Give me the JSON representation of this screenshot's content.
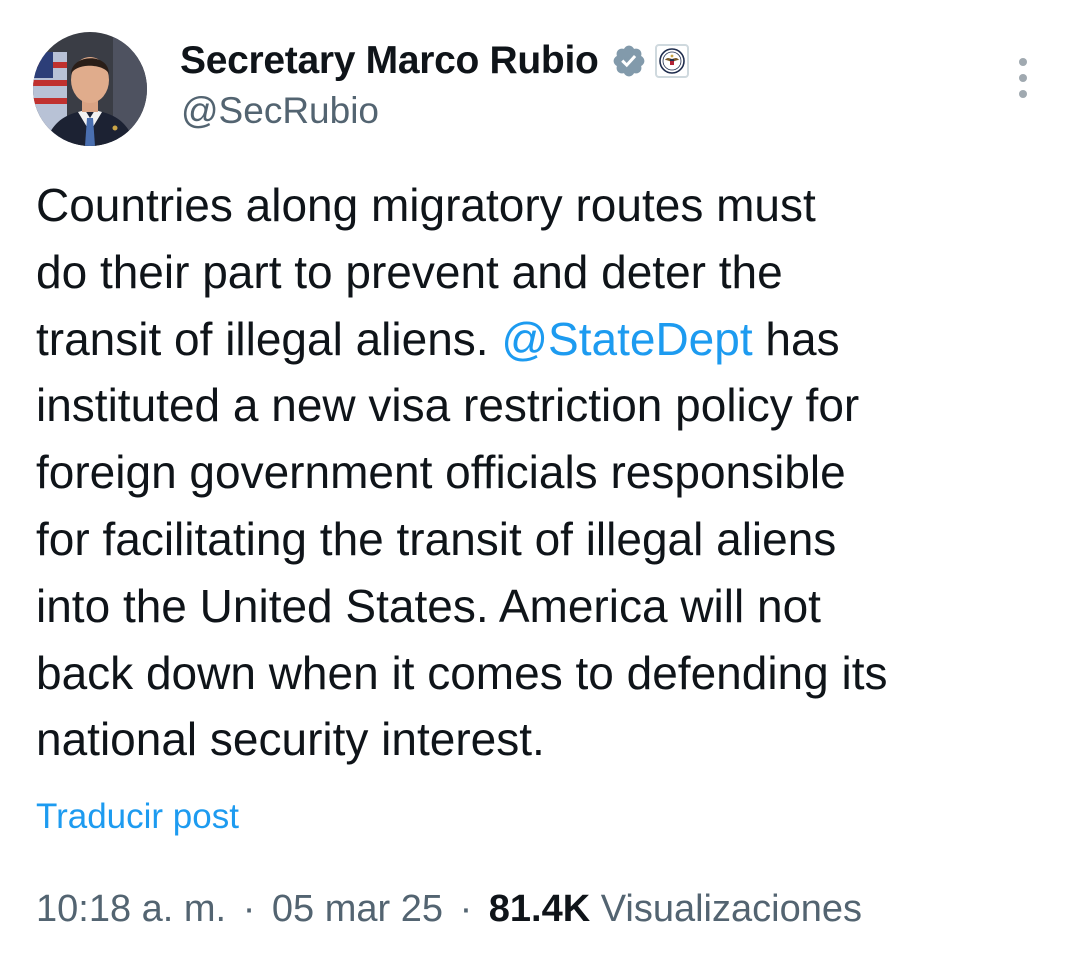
{
  "author": {
    "display_name": "Secretary Marco Rubio",
    "handle": "@SecRubio",
    "verified_icon": "verified-badge-icon",
    "affiliation_icon": "state-department-seal-icon",
    "colors": {
      "verified_badge": "#829aab",
      "mention": "#1d9bf0"
    }
  },
  "menu": {
    "icon": "more-options-icon"
  },
  "tweet": {
    "lines": [
      {
        "parts": [
          {
            "text": "Countries along migratory routes must",
            "type": "text"
          }
        ]
      },
      {
        "parts": [
          {
            "text": "do their part to prevent and deter the",
            "type": "text"
          }
        ]
      },
      {
        "parts": [
          {
            "text": "transit of illegal aliens. ",
            "type": "text"
          },
          {
            "text": "@StateDept",
            "type": "mention"
          },
          {
            "text": " has",
            "type": "text"
          }
        ]
      },
      {
        "parts": [
          {
            "text": "instituted a new visa restriction policy for",
            "type": "text"
          }
        ]
      },
      {
        "parts": [
          {
            "text": "foreign government officials responsible",
            "type": "text"
          }
        ]
      },
      {
        "parts": [
          {
            "text": "for facilitating the transit of illegal aliens",
            "type": "text"
          }
        ]
      },
      {
        "parts": [
          {
            "text": "into the United States. America will not",
            "type": "text"
          }
        ]
      },
      {
        "parts": [
          {
            "text": "back down when it comes to defending its",
            "type": "text"
          }
        ]
      },
      {
        "parts": [
          {
            "text": "national security interest.",
            "type": "text"
          }
        ]
      }
    ]
  },
  "translate_label": "Traducir post",
  "meta": {
    "time": "10:18 a. m.",
    "separator": "·",
    "date": "05 mar 25",
    "views_count": "81.4K",
    "views_label": "Visualizaciones"
  }
}
